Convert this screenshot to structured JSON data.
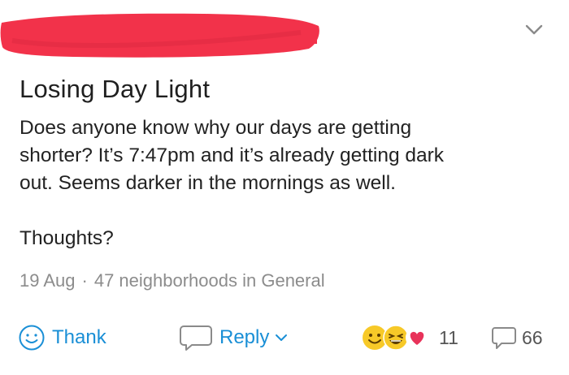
{
  "post": {
    "title": "Losing Day Light",
    "body_lines": [
      "Does anyone know why our days are getting",
      "shorter? It’s 7:47pm and it’s already getting dark",
      "out.  Seems darker in the mornings as well."
    ],
    "closing_line": "Thoughts?",
    "date": "19 Aug",
    "separator": "·",
    "audience": "47 neighborhoods in General"
  },
  "actions": {
    "thank_label": "Thank",
    "reply_label": "Reply",
    "reaction_count": "11",
    "comment_count": "66"
  },
  "colors": {
    "accent": "#1a8fd6",
    "meta": "#8c8c8c",
    "redaction": "#f2324a",
    "reaction_yellow": "#f7c928",
    "reaction_heart": "#e8335a"
  },
  "icons": [
    "chevron-down-icon",
    "smiley-icon",
    "speech-bubble-icon",
    "grin-emoji-icon",
    "laugh-emoji-icon",
    "heart-icon",
    "comment-icon"
  ]
}
